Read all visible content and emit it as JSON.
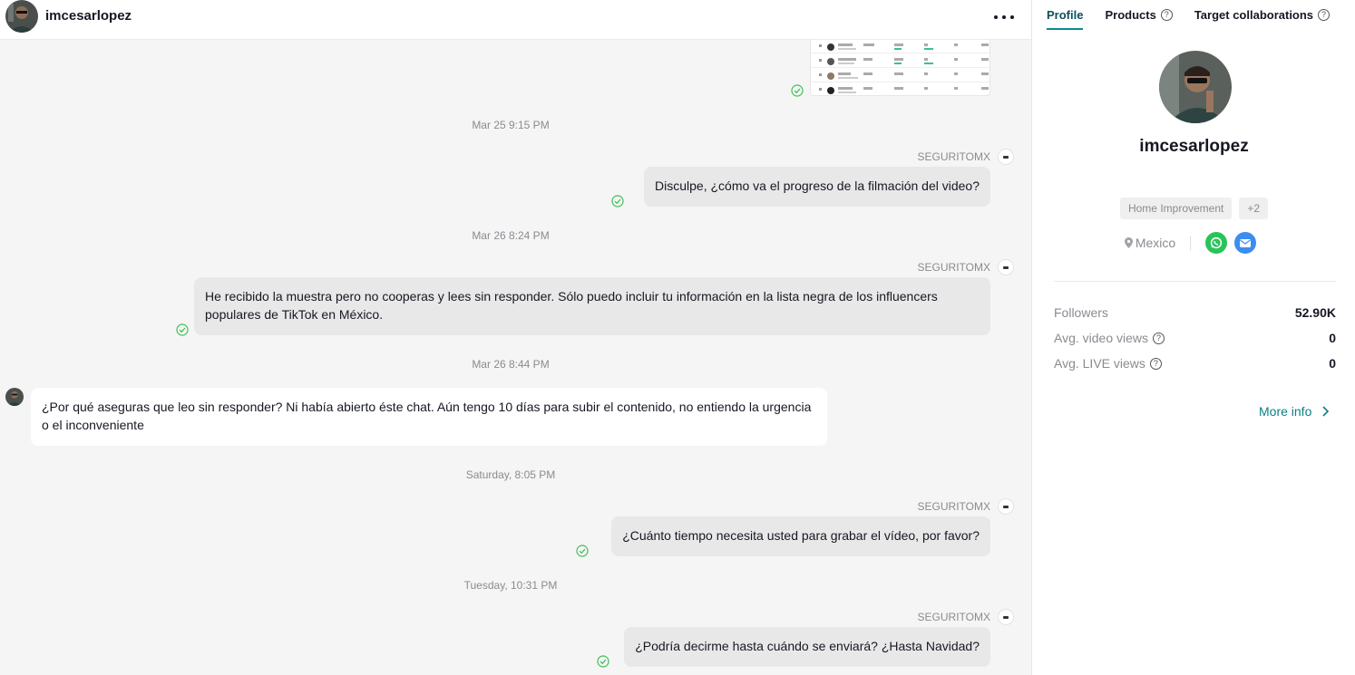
{
  "header": {
    "username": "imcesarlopez"
  },
  "messages": [
    {
      "type": "timestamp",
      "text": "Mar 25 9:15 PM"
    },
    {
      "type": "outgoing",
      "sender": "SEGURITOMX",
      "text": "Disculpe, ¿cómo va el progreso de la filmación del video?"
    },
    {
      "type": "timestamp",
      "text": "Mar 26 8:24 PM"
    },
    {
      "type": "outgoing",
      "sender": "SEGURITOMX",
      "text": "He recibido la muestra pero no cooperas y lees sin responder. Sólo puedo incluir tu información en la lista negra de los influencers populares de TikTok en México."
    },
    {
      "type": "timestamp",
      "text": "Mar 26 8:44 PM"
    },
    {
      "type": "incoming",
      "text": "¿Por qué aseguras que leo sin responder? Ni había abierto éste chat. Aún tengo 10 días para subir el contenido, no entiendo la urgencia o el inconveniente"
    },
    {
      "type": "timestamp",
      "text": "Saturday, 8:05 PM"
    },
    {
      "type": "outgoing",
      "sender": "SEGURITOMX",
      "text": "¿Cuánto tiempo necesita usted para grabar el vídeo, por favor?"
    },
    {
      "type": "timestamp",
      "text": "Tuesday, 10:31 PM"
    },
    {
      "type": "outgoing",
      "sender": "SEGURITOMX",
      "text": "¿Podría decirme hasta cuándo se enviará? ¿Hasta Navidad?"
    }
  ],
  "sidebar": {
    "tabs": [
      "Profile",
      "Products",
      "Target collaborations"
    ],
    "active_tab": "Profile",
    "profile": {
      "name": "imcesarlopez",
      "categories": [
        "Home Improvement",
        "+2"
      ],
      "location": "Mexico"
    },
    "stats": [
      {
        "label": "Followers",
        "value": "52.90K"
      },
      {
        "label": "Avg. video views",
        "value": "0"
      },
      {
        "label": "Avg. LIVE views",
        "value": "0"
      }
    ],
    "more_info": "More info"
  },
  "colors": {
    "accent": "#0a8a8f",
    "read_check": "#3fbf57",
    "outgoing_bubble": "#e8e8e8",
    "whatsapp": "#29c35a",
    "email": "#3c8df0"
  }
}
